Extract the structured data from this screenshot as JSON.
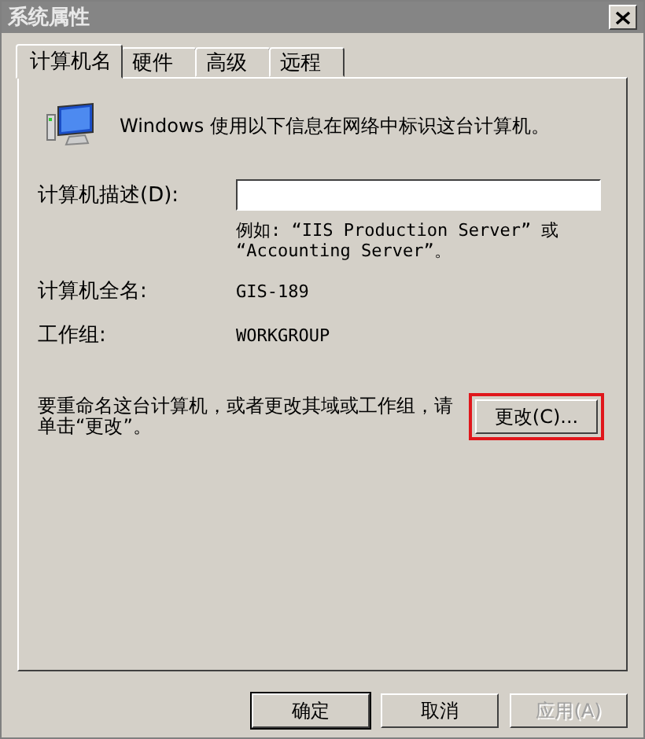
{
  "window": {
    "title": "系统属性"
  },
  "tabs": [
    {
      "label": "计算机名",
      "selected": true
    },
    {
      "label": "硬件",
      "selected": false
    },
    {
      "label": "高级",
      "selected": false
    },
    {
      "label": "远程",
      "selected": false
    }
  ],
  "intro": "Windows 使用以下信息在网络中标识这台计算机。",
  "description": {
    "label": "计算机描述(D):",
    "hint": [
      "例如: “IIS Production Server” 或",
      "“Accounting Server”。"
    ]
  },
  "full_name": {
    "label": "计算机全名:",
    "value": "GIS-189"
  },
  "workgroup": {
    "label": "工作组:",
    "value": "WORKGROUP"
  },
  "rename": {
    "text": "要重命名这台计算机，或者更改其域或工作组，请单击“更改”。",
    "button": "更改(C)...",
    "highlighted": true
  },
  "buttons": [
    {
      "label": "确定",
      "default": true,
      "disabled": false
    },
    {
      "label": "取消",
      "default": false,
      "disabled": false
    },
    {
      "label": "应用(A)",
      "default": false,
      "disabled": true
    }
  ]
}
